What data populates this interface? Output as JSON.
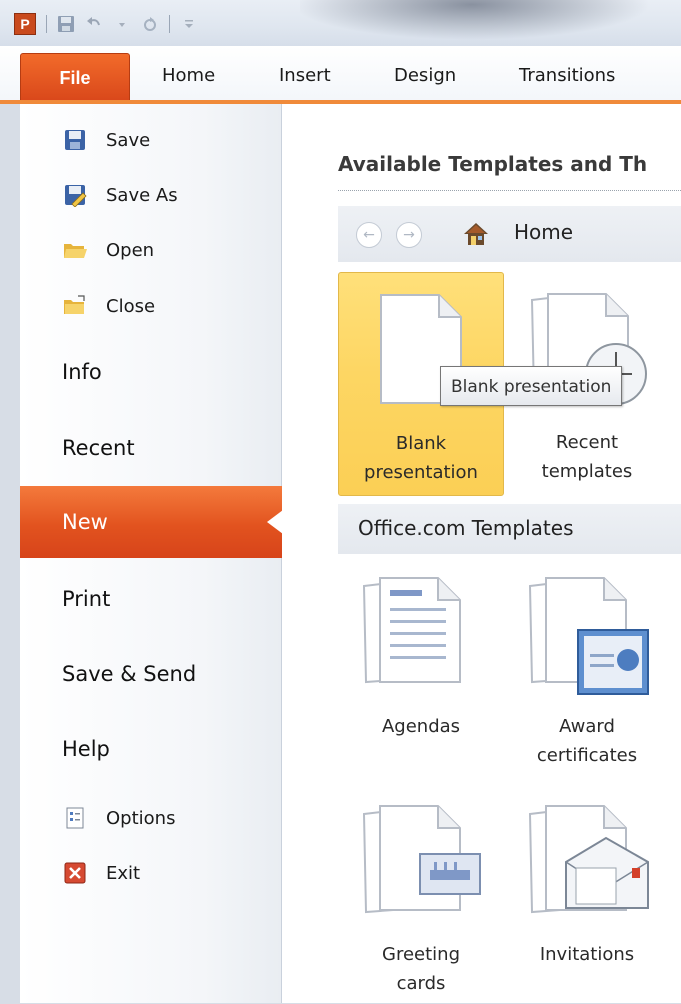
{
  "titlebar": {
    "app_logo": "P",
    "icons": [
      "save-icon",
      "undo-icon",
      "redo-icon",
      "customize-qat-icon"
    ]
  },
  "ribbon": {
    "file_tab": "File",
    "tabs": [
      "Home",
      "Insert",
      "Design",
      "Transitions"
    ],
    "accent_color": "#f08a3a"
  },
  "menu": {
    "save": "Save",
    "save_as": "Save As",
    "open": "Open",
    "close": "Close",
    "info": "Info",
    "recent": "Recent",
    "new": "New",
    "print": "Print",
    "save_send": "Save & Send",
    "help": "Help",
    "options": "Options",
    "exit": "Exit",
    "selected": "New",
    "selected_color": "#e2531f"
  },
  "content": {
    "section_title": "Available Templates and Th",
    "nav": {
      "home_label": "Home"
    },
    "tiles": [
      {
        "line1": "Blank",
        "line2": "presentation",
        "selected": true
      },
      {
        "line1": "Recent",
        "line2": "templates"
      }
    ],
    "tooltip": "Blank presentation",
    "office_header": "Office.com Templates",
    "office_tiles": [
      {
        "line1": "Agendas",
        "line2": ""
      },
      {
        "line1": "Award",
        "line2": "certificates"
      },
      {
        "line1": "Greeting",
        "line2": "cards"
      },
      {
        "line1": "Invitations",
        "line2": ""
      }
    ]
  }
}
